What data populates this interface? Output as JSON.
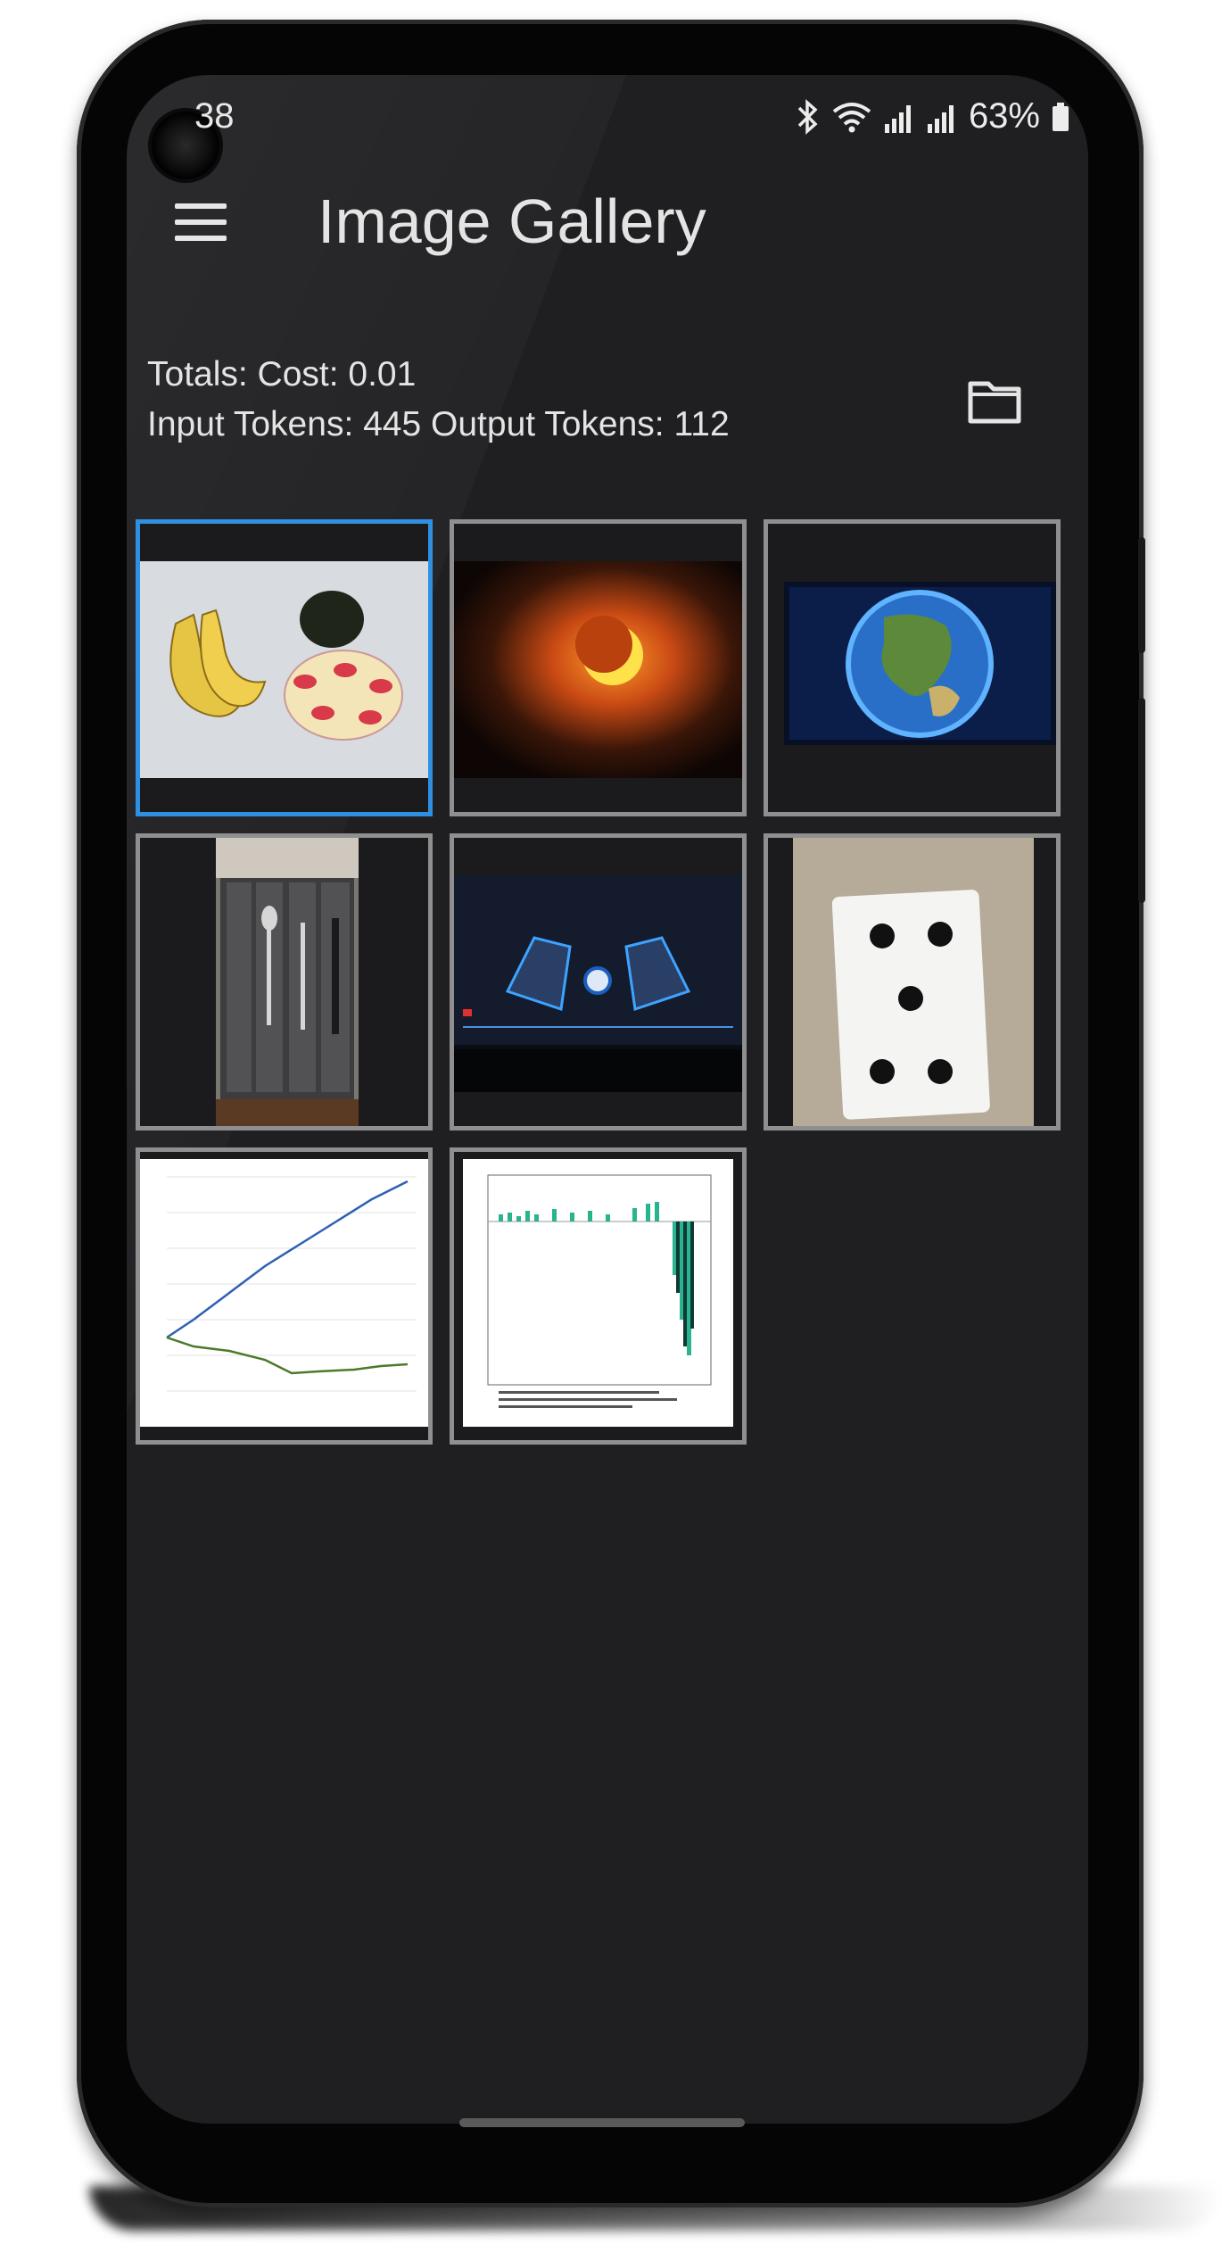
{
  "status_bar": {
    "time": "38",
    "battery": "63%",
    "icons": [
      "bluetooth-icon",
      "wifi-icon",
      "signal-icon",
      "signal-icon",
      "battery-icon"
    ]
  },
  "app_bar": {
    "title": "Image Gallery",
    "menu_icon": "menu-icon"
  },
  "totals": {
    "line1": "Totals: Cost: 0.01",
    "line2": "Input Tokens: 445 Output Tokens: 112",
    "folder_icon": "folder-icon"
  },
  "gallery": {
    "selected_index": 0,
    "accent_color": "#2f8fe0",
    "thumbnails": [
      {
        "subject": "bananas-avocado-photo"
      },
      {
        "subject": "solar-eclipse-photo"
      },
      {
        "subject": "globe-screen-photo"
      },
      {
        "subject": "cutlery-drawer-photo"
      },
      {
        "subject": "car-dashboard-photo"
      },
      {
        "subject": "playing-card-photo"
      },
      {
        "subject": "line-chart-screenshot"
      },
      {
        "subject": "bar-chart-screenshot"
      }
    ]
  }
}
